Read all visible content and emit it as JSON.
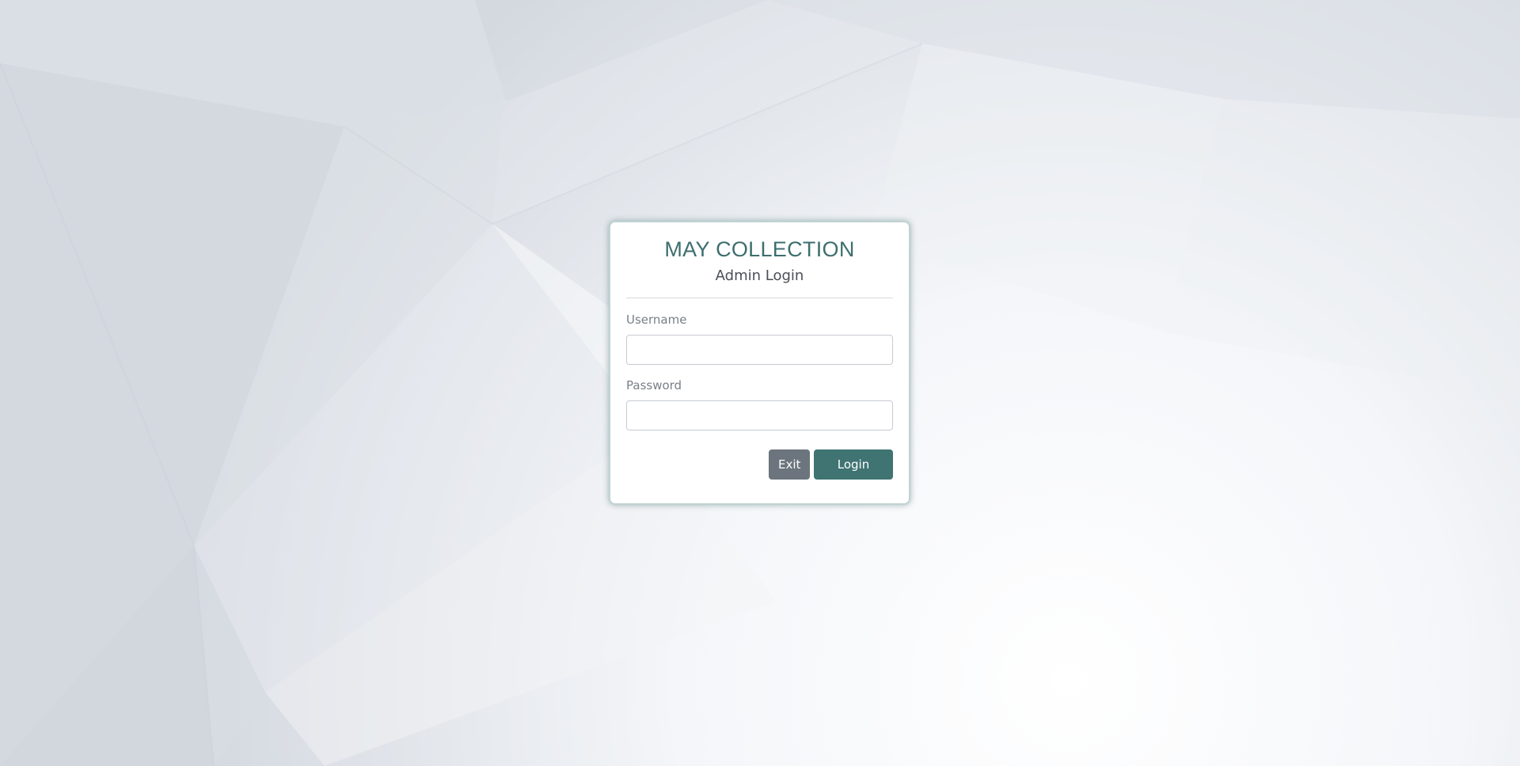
{
  "page": {
    "background_color": "#e6e9ee"
  },
  "login_card": {
    "brand": "MAY COLLECTION",
    "subtitle": "Admin Login",
    "accent_color": "#3f7473",
    "username": {
      "label": "Username",
      "value": "",
      "placeholder": ""
    },
    "password": {
      "label": "Password",
      "value": "",
      "placeholder": ""
    },
    "buttons": {
      "exit_label": "Exit",
      "exit_color": "#6c757d",
      "login_label": "Login",
      "login_color": "#3f7473"
    }
  }
}
